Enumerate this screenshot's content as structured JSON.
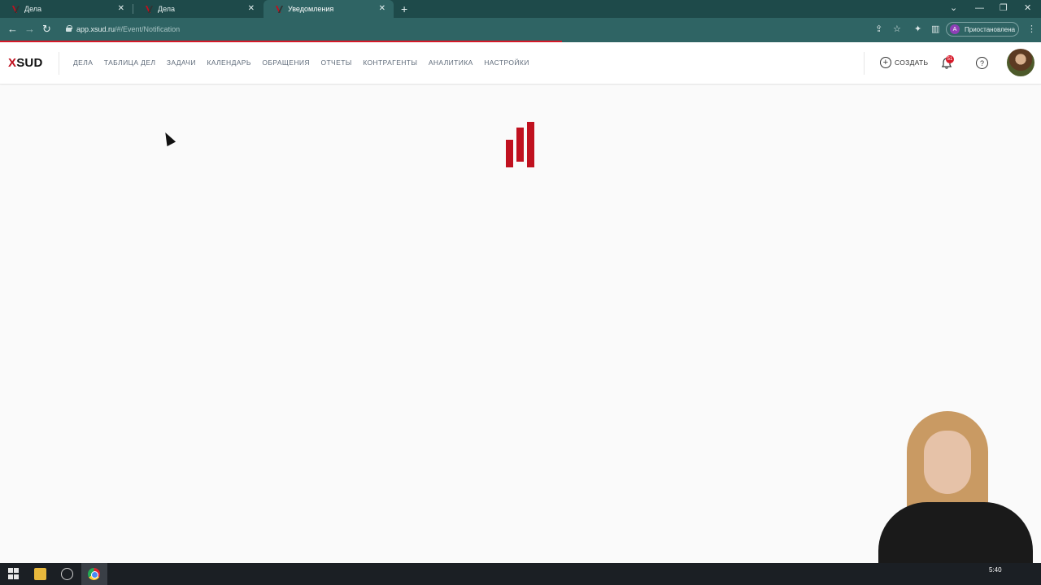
{
  "browser": {
    "tabs": [
      {
        "title": "Дела",
        "active": false
      },
      {
        "title": "Дела",
        "active": false
      },
      {
        "title": "Уведомления",
        "active": true
      }
    ],
    "address": {
      "host": "app.xsud.ru",
      "path": "/#/Event/Notification"
    },
    "profile": {
      "initial": "А",
      "label": "Приостановлена"
    },
    "load_progress": 0.54
  },
  "app": {
    "logo": {
      "x": "X",
      "rest": "SUD"
    },
    "menu": [
      "ДЕЛА",
      "ТАБЛИЦА ДЕЛ",
      "ЗАДАЧИ",
      "КАЛЕНДАРЬ",
      "ОБРАЩЕНИЯ",
      "ОТЧЕТЫ",
      "КОНТРАГЕНТЫ",
      "АНАЛИТИКА",
      "НАСТРОЙКИ"
    ],
    "create_label": "СОЗДАТЬ",
    "notifications_count": "51",
    "help_label": "?"
  },
  "taskbar": {
    "time": "5:40"
  },
  "colors": {
    "brand_red": "#c0111f",
    "chrome_teal": "#2f6464"
  }
}
